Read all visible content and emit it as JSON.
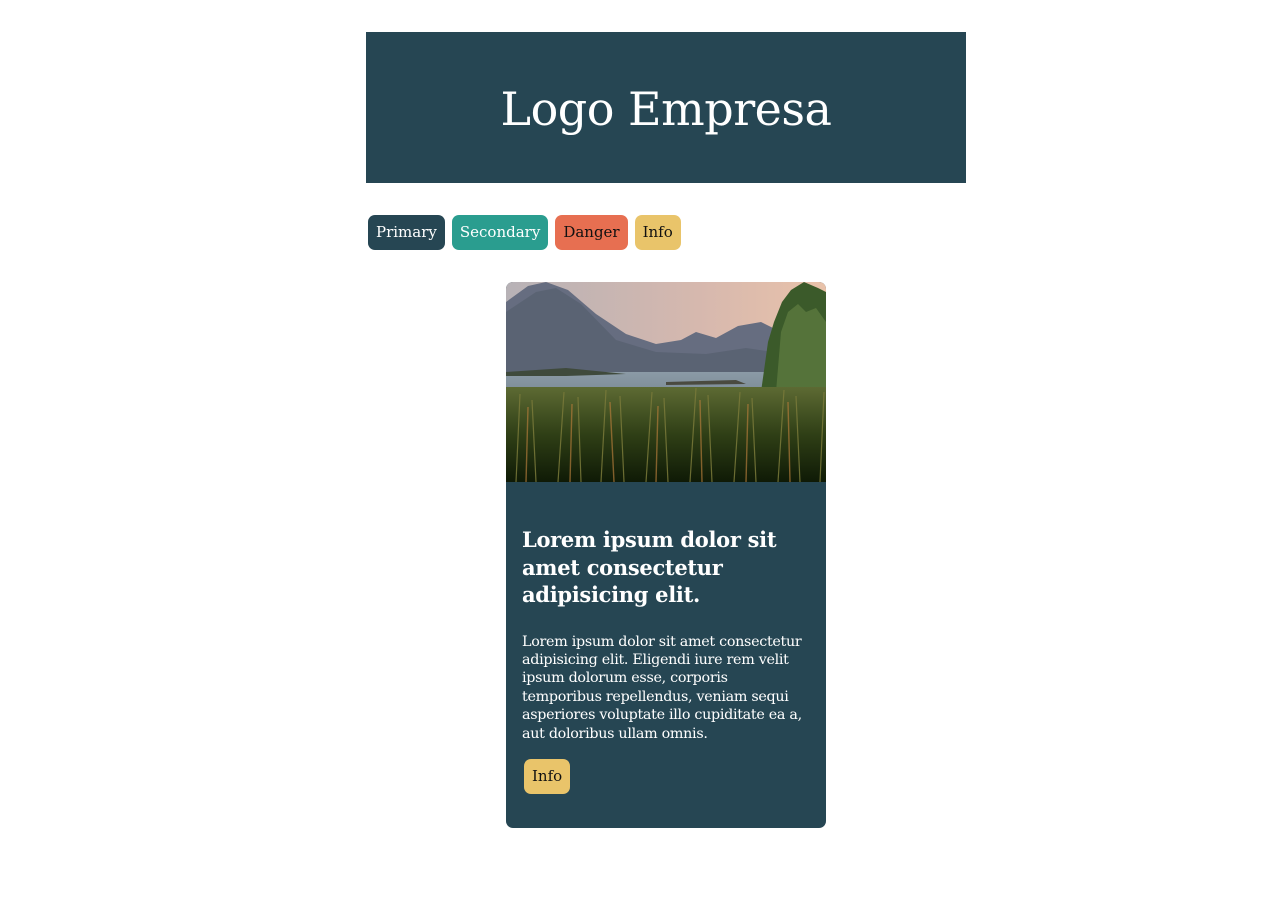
{
  "header": {
    "title": "Logo Empresa"
  },
  "buttons": {
    "primary": "Primary",
    "secondary": "Secondary",
    "danger": "Danger",
    "info": "Info"
  },
  "card": {
    "title": "Lorem ipsum dolor sit amet consectetur adipisicing elit.",
    "text": "Lorem ipsum dolor sit amet consectetur adipisicing elit. Eligendi iure rem velit ipsum dolorum esse, corporis temporibus repellendus, veniam sequi asperiores voluptate illo cupiditate ea a, aut doloribus ullam omnis.",
    "button": "Info"
  },
  "colors": {
    "primary": "#264653",
    "secondary": "#2a9d8f",
    "danger": "#e76f51",
    "info": "#e9c46a"
  }
}
